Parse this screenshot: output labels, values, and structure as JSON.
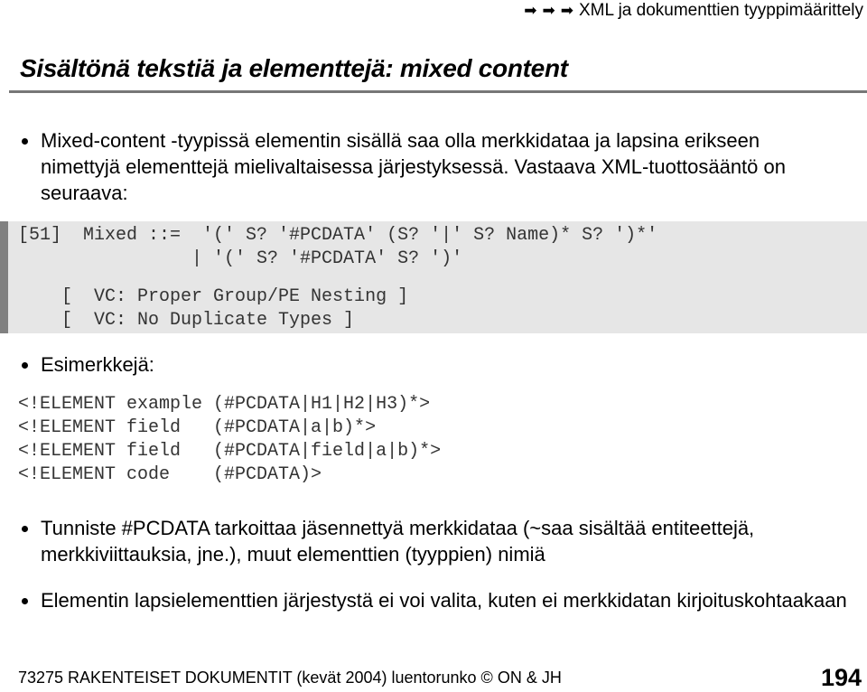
{
  "header": {
    "arrows": [
      "➡",
      "➡",
      "➡"
    ],
    "text": "XML ja dokumenttien tyyppimäärittely"
  },
  "title": "Sisältönä tekstiä ja elementtejä: mixed content",
  "bullets": [
    "Mixed-content -tyypissä elementin sisällä saa olla merkkidataa ja lapsina erikseen nimettyjä elementtejä mielivaltaisessa järjestyksessä. Vastaava XML-tuottosääntö on seuraava:",
    "Esimerkkejä:",
    "Tunniste #PCDATA tarkoittaa jäsennettyä merkkidataa (~saa sisältää entiteettejä, merkkiviittauksia, jne.), muut elementtien (tyyppien) nimiä",
    "Elementin lapsielementtien järjestystä ei voi valita, kuten ei merkkidatan kirjoituskohtaakaan"
  ],
  "production": [
    "[51]  Mixed ::=  '(' S? '#PCDATA' (S? '|' S? Name)* S? ')*'",
    "                | '(' S? '#PCDATA' S? ')'",
    "    [  VC: Proper Group/PE Nesting ]",
    "    [  VC: No Duplicate Types ]"
  ],
  "examples": [
    "<!ELEMENT example (#PCDATA|H1|H2|H3)*>",
    "<!ELEMENT field   (#PCDATA|a|b)*>",
    "<!ELEMENT field   (#PCDATA|field|a|b)*>",
    "<!ELEMENT code    (#PCDATA)>"
  ],
  "footer": "73275 RAKENTEISET DOKUMENTIT (kevät 2004) luentorunko © ON & JH",
  "page_number": "194"
}
